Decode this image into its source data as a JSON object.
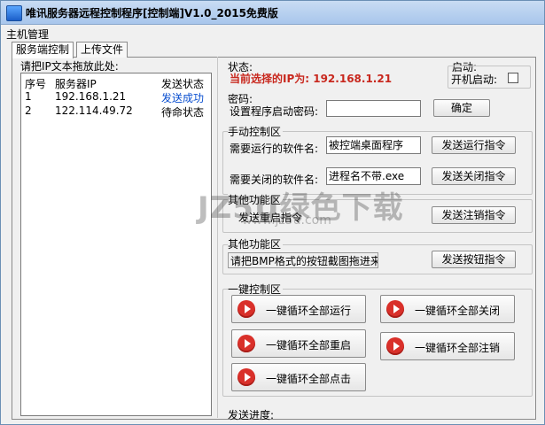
{
  "window": {
    "title": "唯讯服务器远程控制程序[控制端]V1.0_2015免费版"
  },
  "menu": {
    "items": [
      "主机管理"
    ]
  },
  "tabs": [
    {
      "label": "服务端控制"
    },
    {
      "label": "上传文件"
    }
  ],
  "left_panel": {
    "hint": "请把IP文本拖放此处:",
    "columns": [
      "序号",
      "服务器IP",
      "发送状态"
    ],
    "rows": [
      {
        "index": "1",
        "ip": "192.168.1.21",
        "status": "发送成功"
      },
      {
        "index": "2",
        "ip": "122.114.49.72",
        "status": "待命状态"
      }
    ]
  },
  "status": {
    "label": "状态:",
    "current": "当前选择的IP为: 192.168.1.21"
  },
  "startup": {
    "label": "启动:",
    "checkbox_label": "开机启动:"
  },
  "password": {
    "label": "密码:",
    "field_label": "设置程序启动密码:",
    "value": "",
    "confirm": "确定"
  },
  "manual": {
    "title": "手动控制区",
    "run_label": "需要运行的软件名:",
    "run_value": "被控端桌面程序",
    "run_button": "发送运行指令",
    "close_label": "需要关闭的软件名:",
    "close_value": "进程名不带.exe",
    "close_button": "发送关闭指令"
  },
  "other1": {
    "title": "其他功能区",
    "restart_label": "发送重启指令",
    "logout_button": "发送注销指令"
  },
  "other2": {
    "title": "其他功能区",
    "bmp_text": "请把BMP格式的按钮截图拖进来",
    "button": "发送按钮指令"
  },
  "onekey": {
    "title": "一键控制区",
    "buttons": [
      "一键循环全部运行",
      "一键循环全部关闭",
      "一键循环全部重启",
      "一键循环全部注销",
      "一键循环全部点击"
    ]
  },
  "progress": {
    "label": "发送进度:"
  },
  "watermark": {
    "main": "JZ5U绿色下载",
    "sub": "www.jz5u.com"
  },
  "colors": {
    "status_red": "#c8281e",
    "success_blue": "#0a4fd0",
    "play_red": "#d9302a"
  }
}
